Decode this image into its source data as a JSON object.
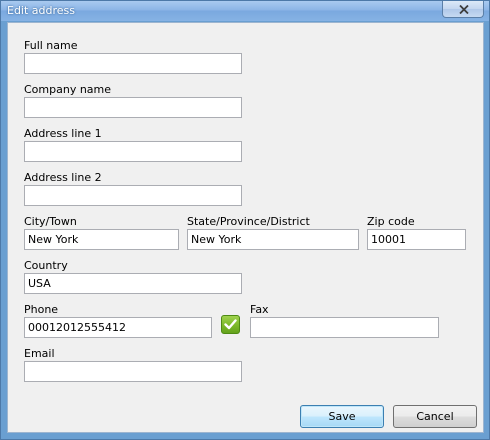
{
  "window": {
    "title": "Edit address"
  },
  "form": {
    "full_name": {
      "label": "Full name",
      "value": ""
    },
    "company_name": {
      "label": "Company name",
      "value": ""
    },
    "address_line1": {
      "label": "Address line 1",
      "value": ""
    },
    "address_line2": {
      "label": "Address line 2",
      "value": ""
    },
    "city": {
      "label": "City/Town",
      "value": "New York"
    },
    "state": {
      "label": "State/Province/District",
      "value": "New York"
    },
    "zip": {
      "label": "Zip code",
      "value": "10001"
    },
    "country": {
      "label": "Country",
      "value": "USA"
    },
    "phone": {
      "label": "Phone",
      "value": "00012012555412"
    },
    "fax": {
      "label": "Fax",
      "value": ""
    },
    "email": {
      "label": "Email",
      "value": ""
    }
  },
  "icons": {
    "close": "close-icon",
    "phone_valid": "checkmark-icon"
  },
  "buttons": {
    "save": "Save",
    "cancel": "Cancel"
  },
  "colors": {
    "title_bar": "#8cb5e6",
    "dialog_background": "#f0f0f0",
    "check_green": "#7cb829"
  }
}
